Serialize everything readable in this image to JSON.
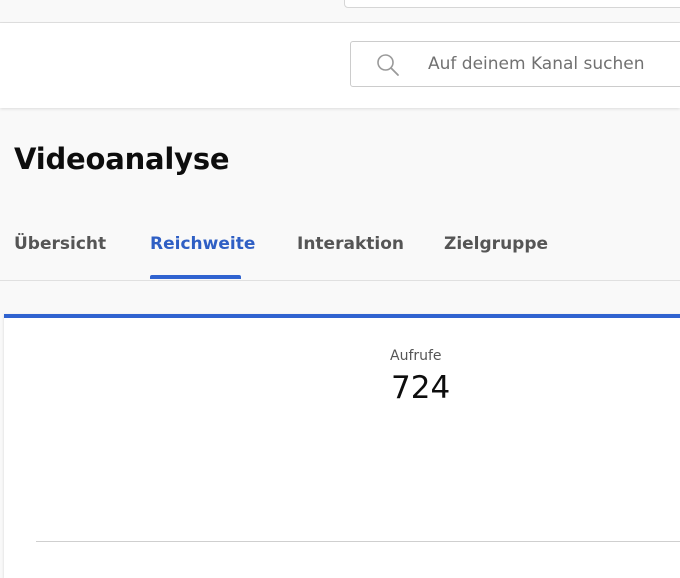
{
  "header": {
    "search": {
      "placeholder": "Auf deinem Kanal suchen"
    }
  },
  "page": {
    "title": "Videoanalyse"
  },
  "tabs": [
    {
      "label": "Übersicht",
      "active": false
    },
    {
      "label": "Reichweite",
      "active": true
    },
    {
      "label": "Interaktion",
      "active": false
    },
    {
      "label": "Zielgruppe",
      "active": false
    }
  ],
  "metric": {
    "label": "Aufrufe",
    "value": "724"
  },
  "colors": {
    "accent": "#3063d0",
    "text_primary": "#0d0d0d",
    "text_secondary": "#555555"
  },
  "icons": {
    "search": "search-icon"
  }
}
